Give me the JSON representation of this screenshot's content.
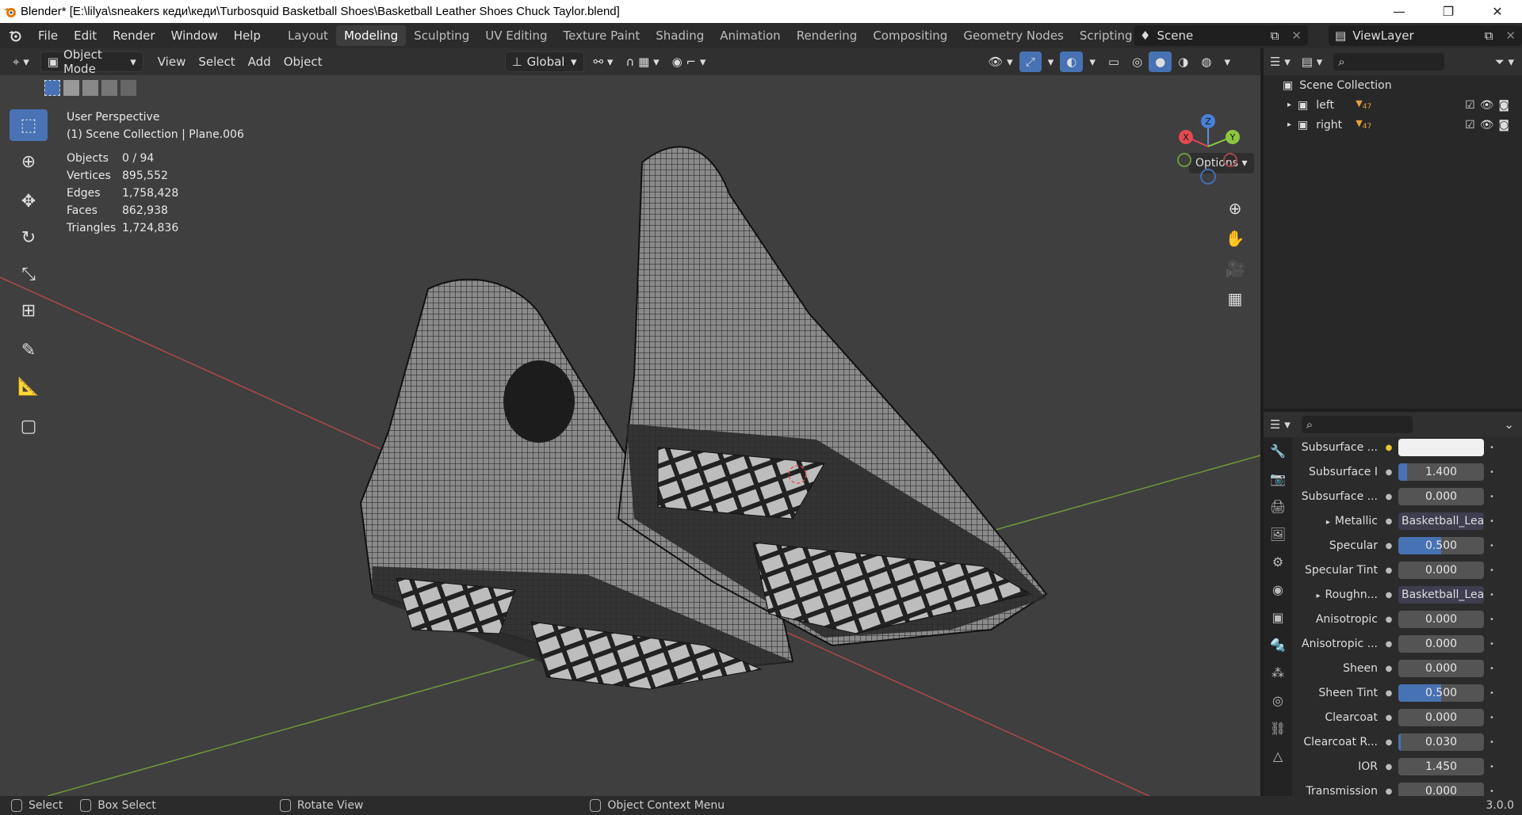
{
  "window": {
    "title": "Blender* [E:\\lilya\\sneakers кеди\\кеди\\Turbosquid Basketball Shoes\\Basketball Leather Shoes Chuck Taylor.blend]",
    "minimize": "—",
    "restore": "❐",
    "close": "✕"
  },
  "menu": [
    "File",
    "Edit",
    "Render",
    "Window",
    "Help"
  ],
  "workspaces": [
    "Layout",
    "Modeling",
    "Sculpting",
    "UV Editing",
    "Texture Paint",
    "Shading",
    "Animation",
    "Rendering",
    "Compositing",
    "Geometry Nodes",
    "Scripting"
  ],
  "active_workspace": "Modeling",
  "scene": {
    "name": "Scene",
    "view_layer": "ViewLayer"
  },
  "header": {
    "mode": "Object Mode",
    "view": "View",
    "select": "Select",
    "add": "Add",
    "object": "Object",
    "orientation": "Global",
    "options": "Options"
  },
  "viewport": {
    "perspective": "User Perspective",
    "collection": "(1) Scene Collection | Plane.006",
    "stats": [
      {
        "k": "Objects",
        "v": "0 / 94"
      },
      {
        "k": "Vertices",
        "v": "895,552"
      },
      {
        "k": "Edges",
        "v": "1,758,428"
      },
      {
        "k": "Faces",
        "v": "862,938"
      },
      {
        "k": "Triangles",
        "v": "1,724,836"
      }
    ],
    "gizmo": {
      "x": "X",
      "y": "Y",
      "z": "Z"
    }
  },
  "outliner": {
    "root": "Scene Collection",
    "items": [
      {
        "name": "left",
        "badge": "47"
      },
      {
        "name": "right",
        "badge": "47"
      }
    ]
  },
  "properties": [
    {
      "label": "Subsurface ...",
      "type": "color",
      "value": ""
    },
    {
      "label": "Subsurface I",
      "type": "num",
      "value": "1.400",
      "fill": 0.1
    },
    {
      "label": "Subsurface ...",
      "type": "num",
      "value": "0.000",
      "fill": 0
    },
    {
      "label": "Metallic",
      "type": "link",
      "value": "Basketball_Lea...",
      "expand": "▸"
    },
    {
      "label": "Specular",
      "type": "num",
      "value": "0.500",
      "fill": 0.5
    },
    {
      "label": "Specular Tint",
      "type": "num",
      "value": "0.000",
      "fill": 0
    },
    {
      "label": "Roughn...",
      "type": "link",
      "value": "Basketball_Lea...",
      "expand": "▸"
    },
    {
      "label": "Anisotropic",
      "type": "num",
      "value": "0.000",
      "fill": 0
    },
    {
      "label": "Anisotropic ...",
      "type": "num",
      "value": "0.000",
      "fill": 0
    },
    {
      "label": "Sheen",
      "type": "num",
      "value": "0.000",
      "fill": 0
    },
    {
      "label": "Sheen Tint",
      "type": "num",
      "value": "0.500",
      "fill": 0.5
    },
    {
      "label": "Clearcoat",
      "type": "num",
      "value": "0.000",
      "fill": 0
    },
    {
      "label": "Clearcoat R...",
      "type": "num",
      "value": "0.030",
      "fill": 0.03
    },
    {
      "label": "IOR",
      "type": "num",
      "value": "1.450",
      "fill": 0
    },
    {
      "label": "Transmission",
      "type": "num",
      "value": "0.000",
      "fill": 0
    }
  ],
  "statusbar": {
    "select": "Select",
    "box_select": "Box Select",
    "rotate": "Rotate View",
    "context": "Object Context Menu",
    "version": "3.0.0"
  },
  "colors": {
    "accent": "#4772b3",
    "viewport_bg": "#3f3f3f"
  }
}
